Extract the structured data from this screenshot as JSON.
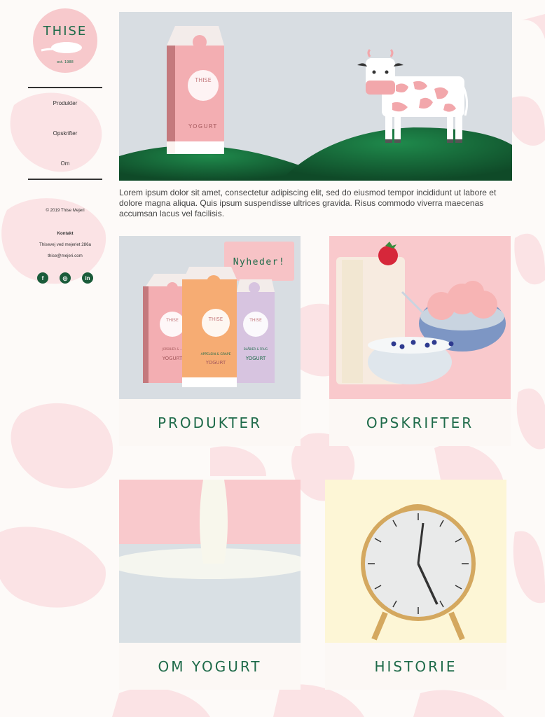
{
  "brand": {
    "name": "THISE",
    "est": "est. 1988"
  },
  "nav": {
    "items": [
      "Produkter",
      "Opskrifter",
      "Om"
    ]
  },
  "footer": {
    "copyright": "© 2019 Thise Mejeri",
    "contact_heading": "Kontakt",
    "address": "Thisevej ved mejeriet 286a",
    "email": "thise@mejeri.com",
    "social": [
      "facebook-icon",
      "instagram-icon",
      "linkedin-icon"
    ]
  },
  "hero": {
    "carton_brand": "THISE",
    "carton_type": "YOGURT"
  },
  "intro": "Lorem ipsum dolor sit amet, consectetur adipiscing elit, sed do eiusmod tempor incididunt ut labore et dolore magna aliqua. Quis ipsum suspendisse ultrices gravida. Risus commodo viverra maecenas accumsan lacus vel facilisis.",
  "cards": [
    {
      "label": "PRODUKTER",
      "badge": "Nyheder!",
      "cartons": [
        {
          "brand": "THISE",
          "flavor": "JORDBÆR & ...",
          "type": "YOGURT"
        },
        {
          "brand": "THISE",
          "flavor": "APPELSIN & GRAPE",
          "type": "YOGURT"
        },
        {
          "brand": "THISE",
          "flavor": "BLÅBÆR & FRUG",
          "type": "YOGURT"
        }
      ]
    },
    {
      "label": "OPSKRIFTER"
    },
    {
      "label": "OM YOGURT"
    },
    {
      "label": "HISTORIE"
    }
  ],
  "colors": {
    "brand_green": "#1f6b4a",
    "pink": "#f9c9cc",
    "sky": "#d8dde2",
    "hill": "#17683a"
  }
}
